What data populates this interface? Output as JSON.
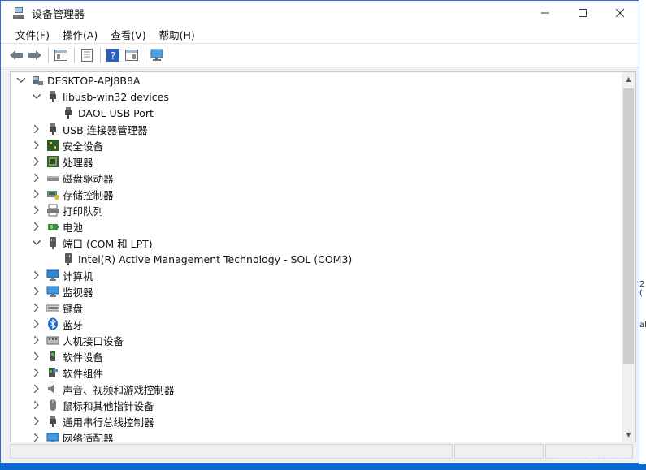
{
  "window": {
    "title": "设备管理器"
  },
  "menu": [
    "文件(F)",
    "操作(A)",
    "查看(V)",
    "帮助(H)"
  ],
  "toolbar": {
    "icons": [
      "back-arrow-icon",
      "forward-arrow-icon",
      "show-hide-tree-icon",
      "properties-icon",
      "help-icon",
      "action-pane-icon",
      "scan-hardware-icon"
    ]
  },
  "tree": {
    "root": "DESKTOP-APJ8B8A",
    "items": [
      {
        "label": "libusb-win32 devices",
        "level": 1,
        "expanded": true,
        "icon": "usb-plug-icon"
      },
      {
        "label": "DAOL USB Port",
        "level": 2,
        "icon": "usb-plug-icon"
      },
      {
        "label": "USB 连接器管理器",
        "level": 1,
        "expanded": false,
        "icon": "usb-plug-icon"
      },
      {
        "label": "安全设备",
        "level": 1,
        "expanded": false,
        "icon": "security-device-icon"
      },
      {
        "label": "处理器",
        "level": 1,
        "expanded": false,
        "icon": "processor-icon"
      },
      {
        "label": "磁盘驱动器",
        "level": 1,
        "expanded": false,
        "icon": "disk-drive-icon"
      },
      {
        "label": "存储控制器",
        "level": 1,
        "expanded": false,
        "icon": "storage-controller-icon"
      },
      {
        "label": "打印队列",
        "level": 1,
        "expanded": false,
        "icon": "printer-icon"
      },
      {
        "label": "电池",
        "level": 1,
        "expanded": false,
        "icon": "battery-icon"
      },
      {
        "label": "端口 (COM 和 LPT)",
        "level": 1,
        "expanded": true,
        "icon": "port-icon"
      },
      {
        "label": "Intel(R) Active Management Technology - SOL (COM3)",
        "level": 2,
        "icon": "port-icon"
      },
      {
        "label": "计算机",
        "level": 1,
        "expanded": false,
        "icon": "computer-icon"
      },
      {
        "label": "监视器",
        "level": 1,
        "expanded": false,
        "icon": "monitor-icon"
      },
      {
        "label": "键盘",
        "level": 1,
        "expanded": false,
        "icon": "keyboard-icon"
      },
      {
        "label": "蓝牙",
        "level": 1,
        "expanded": false,
        "icon": "bluetooth-icon"
      },
      {
        "label": "人机接口设备",
        "level": 1,
        "expanded": false,
        "icon": "hid-icon"
      },
      {
        "label": "软件设备",
        "level": 1,
        "expanded": false,
        "icon": "software-device-icon"
      },
      {
        "label": "软件组件",
        "level": 1,
        "expanded": false,
        "icon": "software-component-icon"
      },
      {
        "label": "声音、视频和游戏控制器",
        "level": 1,
        "expanded": false,
        "icon": "speaker-icon"
      },
      {
        "label": "鼠标和其他指针设备",
        "level": 1,
        "expanded": false,
        "icon": "mouse-icon"
      },
      {
        "label": "通用串行总线控制器",
        "level": 1,
        "expanded": false,
        "icon": "usb-controller-icon"
      },
      {
        "label": "网络适配器",
        "level": 1,
        "expanded": false,
        "icon": "network-adapter-icon"
      }
    ]
  },
  "edge_fragments": [
    "2 (",
    "all"
  ],
  "watermark": "CSDN @sainty07"
}
